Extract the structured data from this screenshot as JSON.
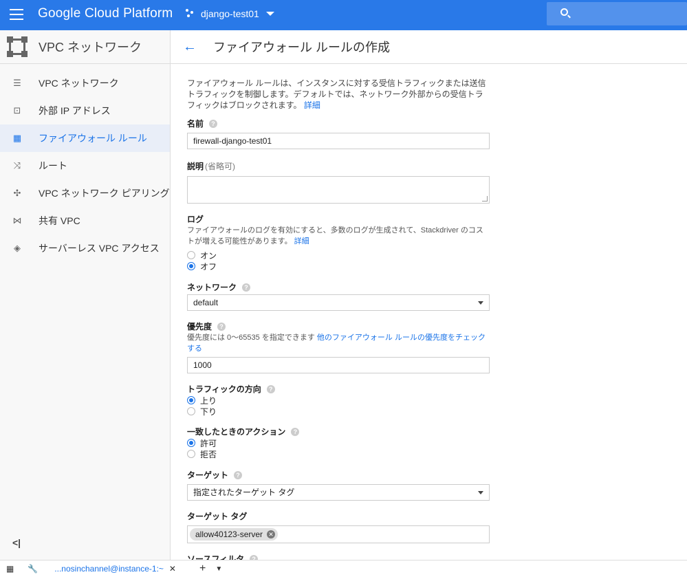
{
  "topbar": {
    "brand": "Google Cloud Platform",
    "project": "django-test01"
  },
  "sidebar": {
    "title": "VPC ネットワーク",
    "items": [
      {
        "label": "VPC ネットワーク",
        "icon": "vpc-network-icon",
        "active": false
      },
      {
        "label": "外部 IP アドレス",
        "icon": "external-ip-icon",
        "active": false
      },
      {
        "label": "ファイアウォール ルール",
        "icon": "firewall-icon",
        "active": true
      },
      {
        "label": "ルート",
        "icon": "route-icon",
        "active": false
      },
      {
        "label": "VPC ネットワーク ピアリング",
        "icon": "peering-icon",
        "active": false
      },
      {
        "label": "共有 VPC",
        "icon": "shared-vpc-icon",
        "active": false
      },
      {
        "label": "サーバーレス VPC アクセス",
        "icon": "serverless-icon",
        "active": false
      }
    ],
    "collapse_label": "<|"
  },
  "header": {
    "title": "ファイアウォール ルールの作成"
  },
  "form": {
    "intro": "ファイアウォール ルールは、インスタンスに対する受信トラフィックまたは送信トラフィックを制御します。デフォルトでは、ネットワーク外部からの受信トラフィックはブロックされます。",
    "intro_link": "詳細",
    "name_label": "名前",
    "name_value": "firewall-django-test01",
    "desc_label": "説明",
    "desc_optional": "(省略可)",
    "log_label": "ログ",
    "log_sub": "ファイアウォールのログを有効にすると、多数のログが生成されて、Stackdriver のコストが増える可能性があります。",
    "log_link": "詳細",
    "log_on": "オン",
    "log_off": "オフ",
    "network_label": "ネットワーク",
    "network_value": "default",
    "priority_label": "優先度",
    "priority_sub": "優先度には 0～65535 を指定できます",
    "priority_link": "他のファイアウォール ルールの優先度をチェックする",
    "priority_value": "1000",
    "direction_label": "トラフィックの方向",
    "direction_in": "上り",
    "direction_out": "下り",
    "action_label": "一致したときのアクション",
    "action_allow": "許可",
    "action_deny": "拒否",
    "target_label": "ターゲット",
    "target_value": "指定されたターゲット タグ",
    "target_tags_label": "ターゲット タグ",
    "target_tag_chip": "allow40123-server",
    "source_filter_label": "ソースフィルタ"
  },
  "bottombar": {
    "tab_label": "...nosinchannel@instance-1:~"
  }
}
